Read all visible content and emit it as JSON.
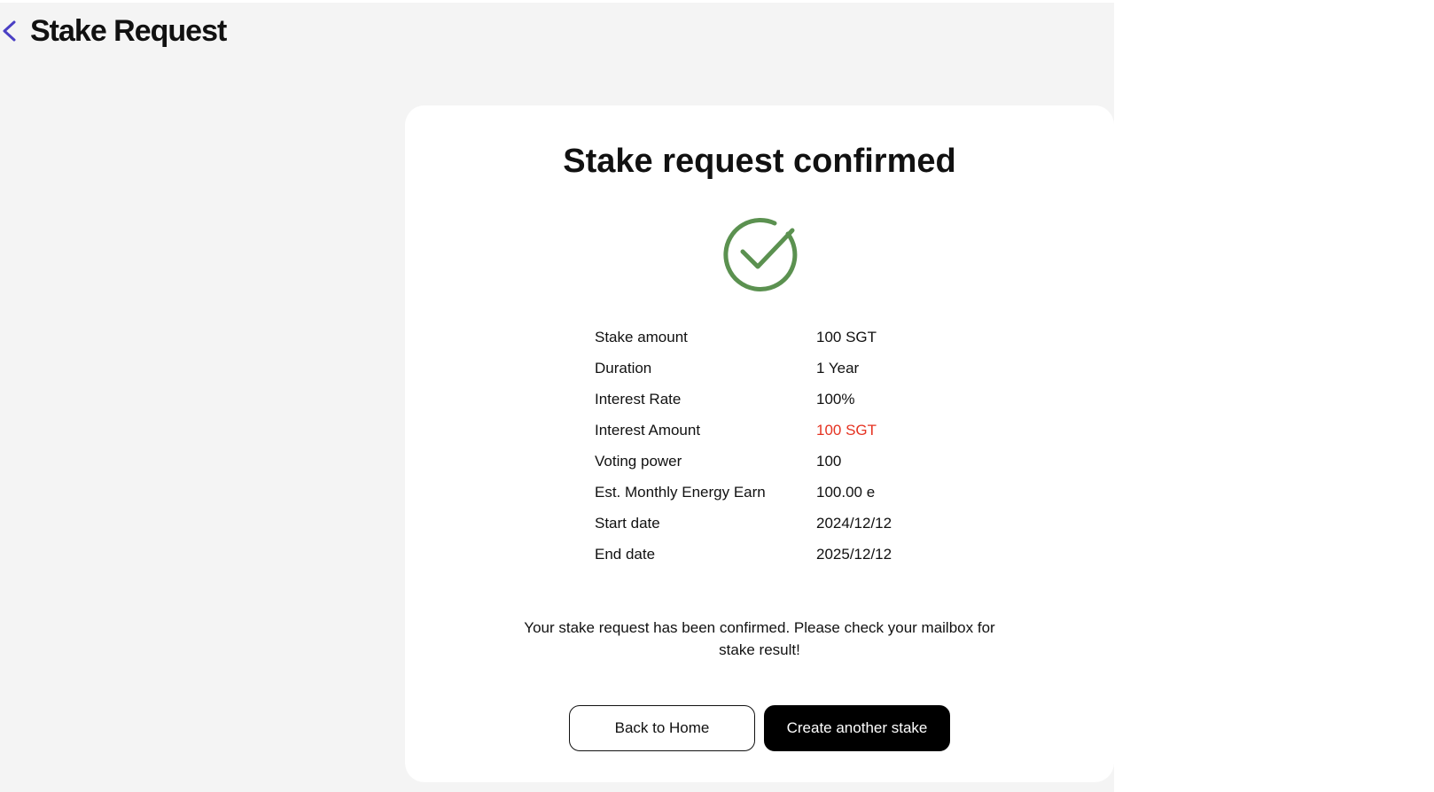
{
  "header": {
    "title": "Stake Request",
    "back_icon": "chevron-left-icon",
    "back_color": "#4a3fc4"
  },
  "card": {
    "title": "Stake request confirmed",
    "status_icon": "check-circle-icon",
    "status_color": "#5b9150",
    "details": [
      {
        "label": "Stake amount",
        "value": "100 SGT"
      },
      {
        "label": "Duration",
        "value": "1 Year"
      },
      {
        "label": "Interest Rate",
        "value": "100%"
      },
      {
        "label": "Interest Amount",
        "value": "100 SGT",
        "highlight": true
      },
      {
        "label": "Voting power",
        "value": "100"
      },
      {
        "label": "Est. Monthly Energy Earn",
        "value": "100.00 e"
      },
      {
        "label": "Start date",
        "value": "2024/12/12"
      },
      {
        "label": "End date",
        "value": "2025/12/12"
      }
    ],
    "highlight_color": "#e53322",
    "message": "Your stake request has been confirmed. Please check your mailbox for stake result!",
    "back_home_label": "Back to Home",
    "create_another_label": "Create another stake"
  }
}
